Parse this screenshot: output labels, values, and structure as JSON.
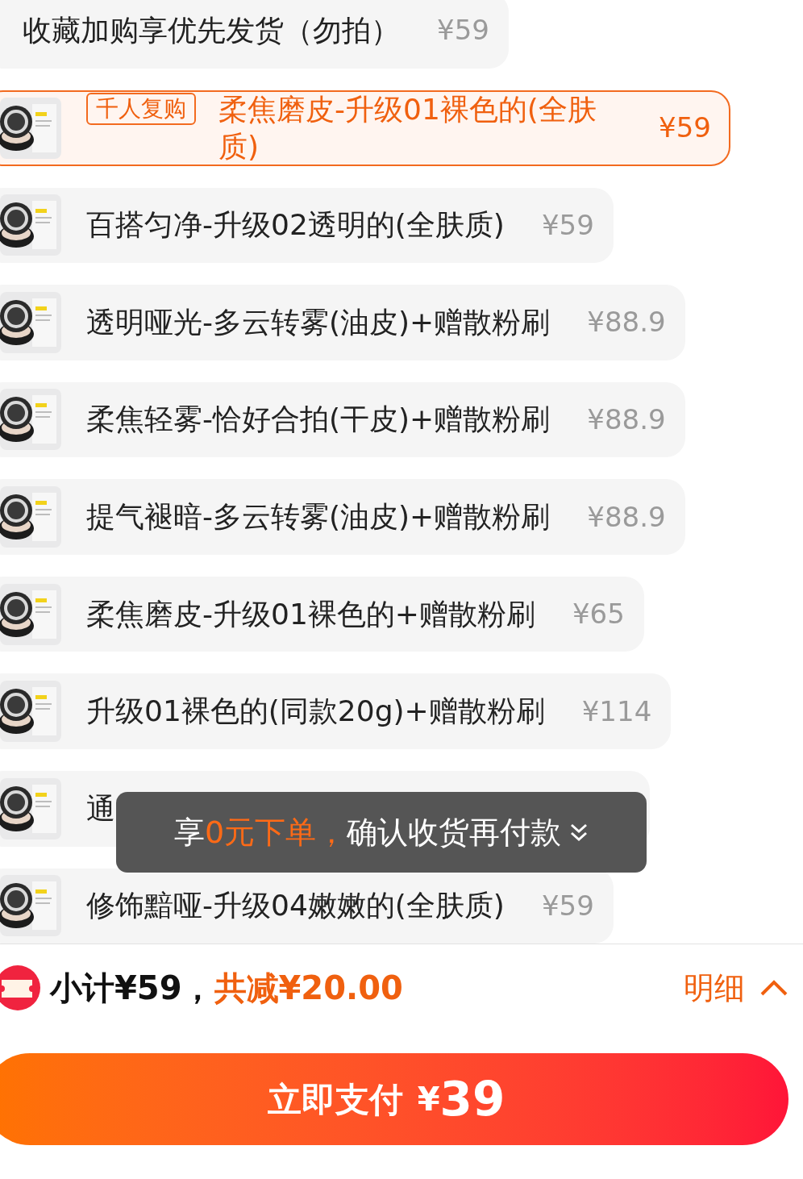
{
  "items": [
    {
      "kind": "plain",
      "name": "收藏加购享优先发货（勿拍）",
      "price": "¥59",
      "selected": false
    },
    {
      "badge": "千人复购",
      "name": "柔焦磨皮-升级01裸色的(全肤质)",
      "price": "¥59",
      "selected": true
    },
    {
      "name": "百搭匀净-升级02透明的(全肤质)",
      "price": "¥59",
      "selected": false
    },
    {
      "name": "透明哑光-多云转雾(油皮)+赠散粉刷",
      "price": "¥88.9",
      "selected": false
    },
    {
      "name": "柔焦轻雾-恰好合拍(干皮)+赠散粉刷",
      "price": "¥88.9",
      "selected": false
    },
    {
      "name": "提气褪暗-多云转雾(油皮)+赠散粉刷",
      "price": "¥88.9",
      "selected": false
    },
    {
      "name": "柔焦磨皮-升级01裸色的+赠散粉刷",
      "price": "¥65",
      "selected": false
    },
    {
      "name": "升级01裸色的(同款20g)+赠散粉刷",
      "price": "¥114",
      "selected": false
    },
    {
      "name": "通",
      "selected": false
    },
    {
      "name": "修饰黯哑-升级04嫩嫩的(全肤质)",
      "price": "¥59",
      "selected": false
    }
  ],
  "toast": {
    "prefix": "享",
    "highlight": "0元下单，",
    "rest": "确认收货再付款"
  },
  "summary": {
    "subtotal": "小计¥59，",
    "discount": "共减¥20.00",
    "details": "明细"
  },
  "pay_button": {
    "label": "立即支付",
    "currency": "¥",
    "amount": "39"
  }
}
